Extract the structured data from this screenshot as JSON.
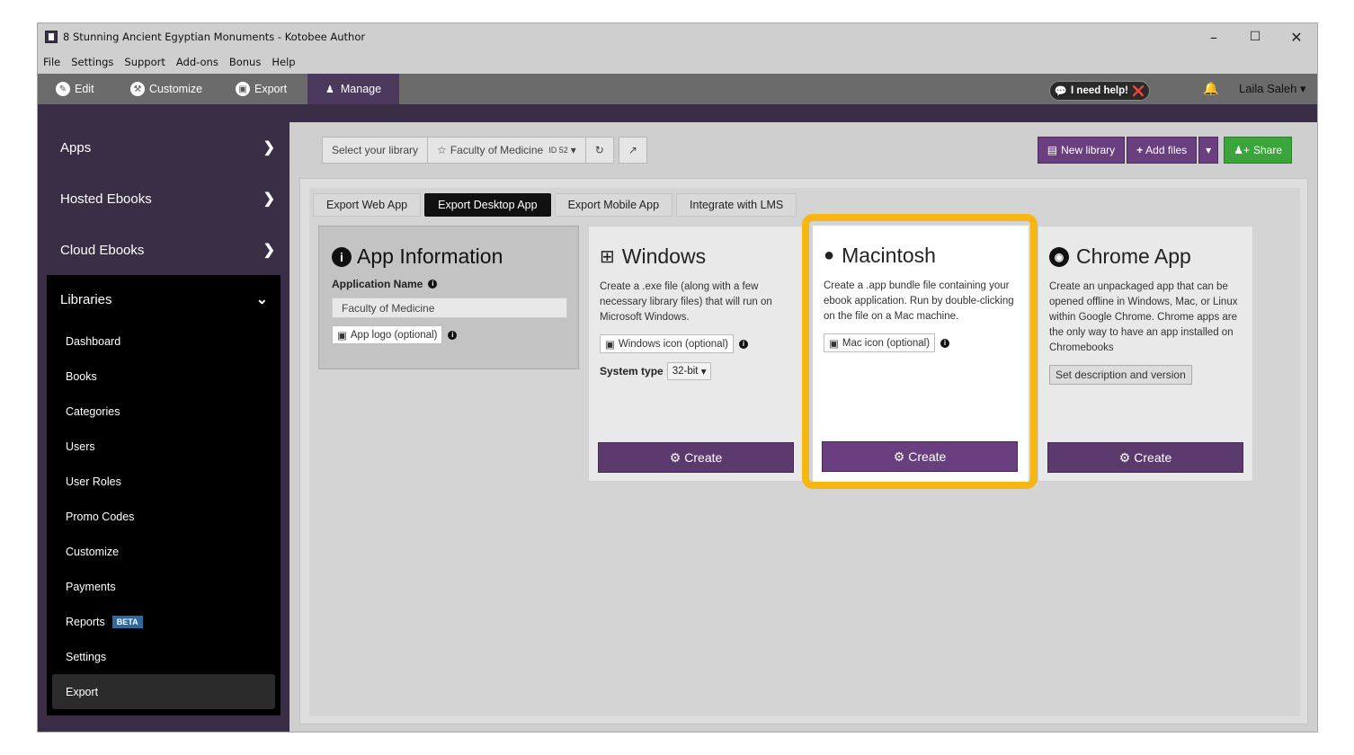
{
  "window": {
    "title": "8 Stunning Ancient Egyptian Monuments - Kotobee Author",
    "controls": [
      "–",
      "☐",
      "✕"
    ]
  },
  "menu": [
    "File",
    "Settings",
    "Support",
    "Add-ons",
    "Bonus",
    "Help"
  ],
  "toolbar": {
    "tabs": [
      {
        "label": "Edit",
        "icon": "pencil-icon"
      },
      {
        "label": "Customize",
        "icon": "wrench-icon"
      },
      {
        "label": "Export",
        "icon": "export-icon"
      },
      {
        "label": "Manage",
        "icon": "user-icon"
      }
    ],
    "help": "I need help!",
    "user": "Laila Saleh"
  },
  "sidebar": {
    "top_items": [
      "Apps",
      "Hosted Ebooks",
      "Cloud Ebooks"
    ],
    "libraries": {
      "label": "Libraries",
      "items": [
        "Dashboard",
        "Books",
        "Categories",
        "Users",
        "User Roles",
        "Promo Codes",
        "Customize",
        "Payments",
        "Reports",
        "Settings",
        "Export"
      ],
      "beta_badge": "BETA",
      "active": "Export"
    }
  },
  "library_bar": {
    "select_label": "Select your library",
    "library_name": "Faculty of Medicine",
    "library_id": "ID 52",
    "new_library": "New library",
    "add_files": "Add files",
    "share": "Share"
  },
  "subtabs": [
    "Export Web App",
    "Export Desktop App",
    "Export Mobile App",
    "Integrate with LMS"
  ],
  "app_info": {
    "title": "App Information",
    "name_label": "Application Name",
    "name_value": "Faculty of Medicine",
    "logo_button": "App logo (optional)"
  },
  "cards": {
    "windows": {
      "title": "Windows",
      "desc": "Create a .exe file (along with a few necessary library files) that will run on Microsoft Windows.",
      "icon_button": "Windows icon (optional)",
      "system_type_label": "System type",
      "system_type_value": "32-bit",
      "create": "Create"
    },
    "mac": {
      "title": "Macintosh",
      "desc": "Create a .app bundle file containing your ebook application. Run by double-clicking on the file on a Mac machine.",
      "icon_button": "Mac icon (optional)",
      "create": "Create"
    },
    "chrome": {
      "title": "Chrome App",
      "desc": "Create an unpackaged app that can be opened offline in Windows, Mac, or Linux within Google Chrome. Chrome apps are the only way to have an app installed on Chromebooks",
      "set_desc": "Set description and version",
      "create": "Create"
    }
  },
  "colors": {
    "accent_purple": "#5c3a6e",
    "sidebar_bg": "#3a2e47",
    "highlight": "#f6b712",
    "share_green": "#3aa53a"
  }
}
